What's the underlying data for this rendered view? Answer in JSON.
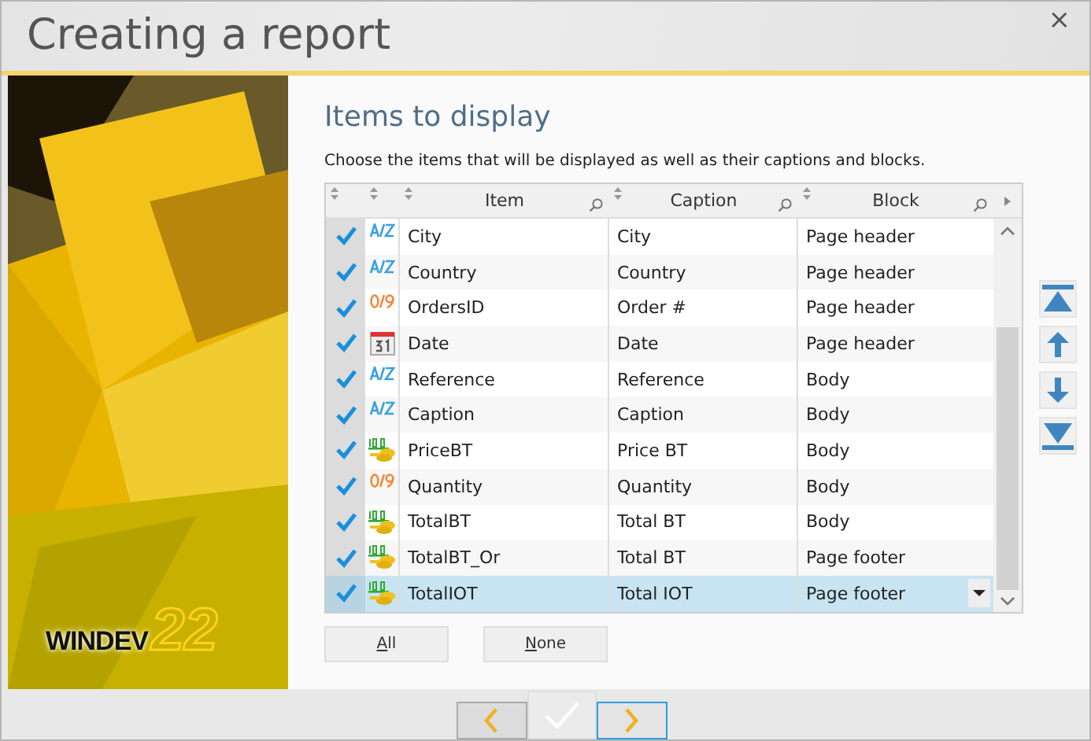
{
  "window": {
    "title": "Creating a report",
    "close": "×"
  },
  "logo": {
    "brand": "WINDEV",
    "version": "22"
  },
  "section": {
    "heading": "Items to display",
    "instructions": "Choose the items that will be displayed as well as their captions and blocks."
  },
  "table": {
    "columns": [
      "Item",
      "Caption",
      "Block"
    ],
    "rows": [
      {
        "kind": "text",
        "item": "City",
        "caption": "City",
        "block": "Page header",
        "checked": true,
        "selected": false
      },
      {
        "kind": "text",
        "item": "Country",
        "caption": "Country",
        "block": "Page header",
        "checked": true,
        "selected": false
      },
      {
        "kind": "number",
        "item": "OrdersID",
        "caption": "Order #",
        "block": "Page header",
        "checked": true,
        "selected": false
      },
      {
        "kind": "date",
        "item": "Date",
        "caption": "Date",
        "block": "Page header",
        "checked": true,
        "selected": false
      },
      {
        "kind": "text",
        "item": "Reference",
        "caption": "Reference",
        "block": "Body",
        "checked": true,
        "selected": false
      },
      {
        "kind": "text",
        "item": "Caption",
        "caption": "Caption",
        "block": "Body",
        "checked": true,
        "selected": false
      },
      {
        "kind": "currency",
        "item": "PriceBT",
        "caption": "Price BT",
        "block": "Body",
        "checked": true,
        "selected": false
      },
      {
        "kind": "number",
        "item": "Quantity",
        "caption": "Quantity",
        "block": "Body",
        "checked": true,
        "selected": false
      },
      {
        "kind": "currency",
        "item": "TotalBT",
        "caption": "Total BT",
        "block": "Body",
        "checked": true,
        "selected": false
      },
      {
        "kind": "currency",
        "item": "TotalBT_Or",
        "caption": "Total BT",
        "block": "Page footer",
        "checked": true,
        "selected": false
      },
      {
        "kind": "currency",
        "item": "TotalIOT",
        "caption": "Total IOT",
        "block": "Page footer",
        "checked": true,
        "selected": true
      }
    ]
  },
  "list_buttons": [
    "All",
    "None"
  ]
}
